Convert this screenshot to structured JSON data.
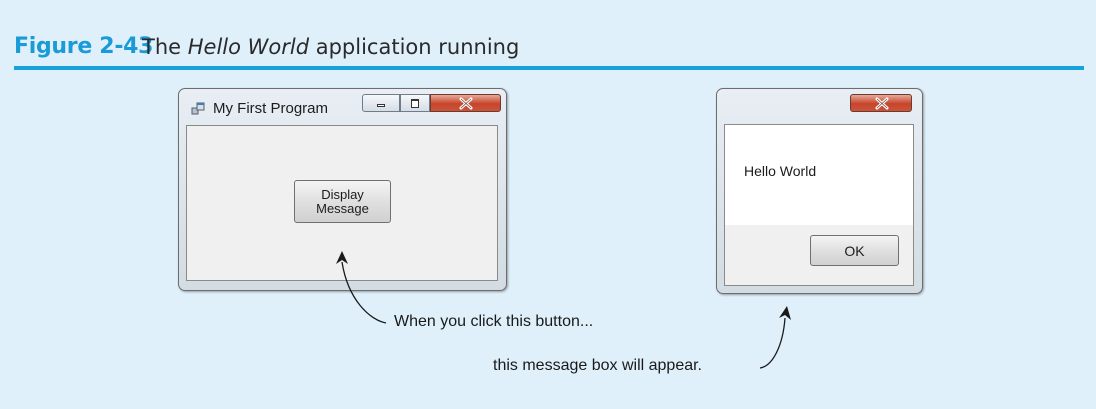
{
  "figure": {
    "number": "Figure 2-43",
    "caption_prefix": "The ",
    "caption_italic": "Hello World",
    "caption_suffix": " application running"
  },
  "form_window": {
    "title": "My First Program",
    "button_line1": "Display",
    "button_line2": "Message"
  },
  "message_box": {
    "text": "Hello World",
    "ok_label": "OK"
  },
  "annotations": {
    "button_callout": "When you click this button...",
    "box_callout": "this message box will appear."
  },
  "colors": {
    "accent": "#1a9bd7",
    "background": "#dff0fa"
  }
}
